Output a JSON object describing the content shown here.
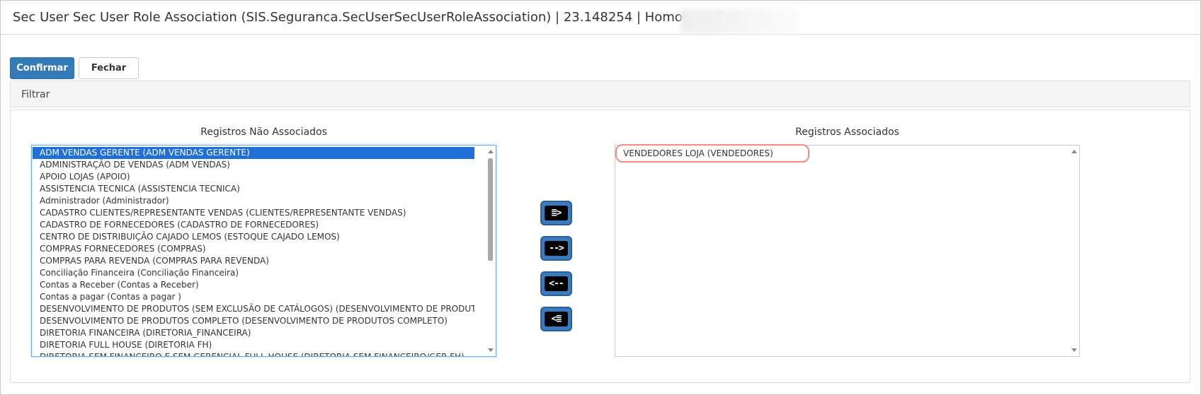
{
  "window": {
    "title": "Sec User Sec User Role Association (SIS.Seguranca.SecUserSecUserRoleAssociation) | 23.148254 | Homologação |"
  },
  "toolbar": {
    "confirm_label": "Confirmar",
    "close_label": "Fechar"
  },
  "filter": {
    "label": "Filtrar"
  },
  "unassociated": {
    "title": "Registros Não Associados",
    "items": [
      "ADM VENDAS GERENTE (ADM VENDAS GERENTE)",
      "ADMINISTRAÇÃO DE VENDAS (ADM VENDAS)",
      "APOIO LOJAS (APOIO)",
      "ASSISTENCIA TECNICA (ASSISTENCIA TECNICA)",
      "Administrador (Administrador)",
      "CADASTRO CLIENTES/REPRESENTANTE VENDAS (CLIENTES/REPRESENTANTE VENDAS)",
      "CADASTRO DE FORNECEDORES (CADASTRO DE FORNECEDORES)",
      "CENTRO DE DISTRIBUIÇÃO CAJADO LEMOS (ESTOQUE CAJADO LEMOS)",
      "COMPRAS FORNECEDORES (COMPRAS)",
      "COMPRAS PARA REVENDA (COMPRAS PARA REVENDA)",
      "Conciliação Financeira (Conciliação Financeira)",
      "Contas a Receber (Contas a Receber)",
      "Contas a pagar (Contas a pagar )",
      "DESENVOLVIMENTO DE PRODUTOS (SEM EXCLUSÃO DE CATÁLOGOS) (DESENVOLVIMENTO DE PRODUTOS (SEM",
      "DESENVOLVIMENTO DE PRODUTOS COMPLETO (DESENVOLVIMENTO DE PRODUTOS COMPLETO)",
      "DIRETORIA FINANCEIRA (DIRETORIA_FINANCEIRA)",
      "DIRETORIA FULL HOUSE (DIRETORIA FH)",
      "DIRETORIA SEM FINANCEIRO E SEM GERENCIAL FULL HOUSE (DIRETORIA SEM FINANCEIRO/GER FH)"
    ],
    "selected_index": 0
  },
  "associated": {
    "title": "Registros Associados",
    "items": [
      "VENDEDORES LOJA (VENDEDORES)"
    ]
  },
  "move_buttons": {
    "add_all": "≣>",
    "add_one": "-->",
    "remove_one": "<--",
    "remove_all": "<≣"
  },
  "colors": {
    "primary": "#337ab7",
    "selection": "#1f6fd6",
    "highlight_border": "#ef8b8b"
  }
}
